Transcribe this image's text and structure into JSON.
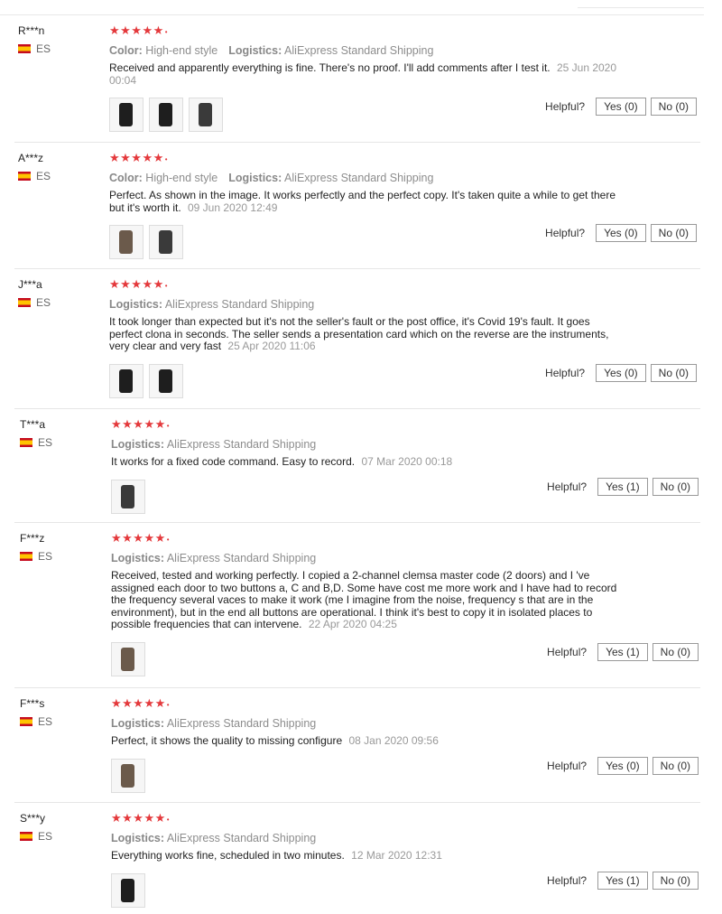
{
  "reviews": [
    {
      "user": "R***n",
      "country": "ES",
      "stars": "★★★★★",
      "color_label": "Color:",
      "color_value": "High-end style",
      "logistics_label": "Logistics:",
      "logistics_value": "AliExpress Standard Shipping",
      "text": "Received and apparently everything is fine. There's no proof. I'll add comments after I test it.",
      "date": "25 Jun 2020 00:04",
      "helpful": "Helpful?",
      "yes": "Yes (0)",
      "no": "No (0)"
    },
    {
      "user": "A***z",
      "country": "ES",
      "stars": "★★★★★",
      "color_label": "Color:",
      "color_value": "High-end style",
      "logistics_label": "Logistics:",
      "logistics_value": "AliExpress Standard Shipping",
      "text": "Perfect. As shown in the image. It works perfectly and the perfect copy. It's taken quite a while to get there but it's worth it.",
      "date": "09 Jun 2020 12:49",
      "helpful": "Helpful?",
      "yes": "Yes (0)",
      "no": "No (0)"
    },
    {
      "user": "J***a",
      "country": "ES",
      "stars": "★★★★★",
      "logistics_label": "Logistics:",
      "logistics_value": "AliExpress Standard Shipping",
      "text": "It took longer than expected but it's not the seller's fault or the post office, it's Covid 19's fault. It goes perfect clona in seconds. The seller sends a presentation card which on the reverse are the instruments, very clear and very fast",
      "date": "25 Apr 2020 11:06",
      "helpful": "Helpful?",
      "yes": "Yes (0)",
      "no": "No (0)"
    },
    {
      "user": "T***a",
      "country": "ES",
      "stars": "★★★★★",
      "logistics_label": "Logistics:",
      "logistics_value": "AliExpress Standard Shipping",
      "text": "It works for a fixed code command. Easy to record.",
      "date": "07 Mar 2020 00:18",
      "helpful": "Helpful?",
      "yes": "Yes (1)",
      "no": "No (0)"
    },
    {
      "user": "F***z",
      "country": "ES",
      "stars": "★★★★★",
      "logistics_label": "Logistics:",
      "logistics_value": "AliExpress Standard Shipping",
      "text": "Received, tested and working perfectly. I copied a 2-channel clemsa master code (2 doors) and I 've assigned each door to two buttons a, C and B,D. Some have cost me more work and I have had to record the frequency several vaces to make it work (me I imagine from the noise, frequency s that are in the environment), but in the end all buttons are operational. I think it's best to copy it in isolated places to possible frequencies that can intervene.",
      "date": "22 Apr 2020 04:25",
      "helpful": "Helpful?",
      "yes": "Yes (1)",
      "no": "No (0)"
    },
    {
      "user": "F***s",
      "country": "ES",
      "stars": "★★★★★",
      "logistics_label": "Logistics:",
      "logistics_value": "AliExpress Standard Shipping",
      "text": "Perfect, it shows the quality to missing configure",
      "date": "08 Jan 2020 09:56",
      "helpful": "Helpful?",
      "yes": "Yes (0)",
      "no": "No (0)"
    },
    {
      "user": "S***y",
      "country": "ES",
      "stars": "★★★★★",
      "logistics_label": "Logistics:",
      "logistics_value": "AliExpress Standard Shipping",
      "text": "Everything works fine, scheduled in two minutes.",
      "date": "12 Mar 2020 12:31",
      "helpful": "Helpful?",
      "yes": "Yes (1)",
      "no": "No (0)"
    }
  ]
}
